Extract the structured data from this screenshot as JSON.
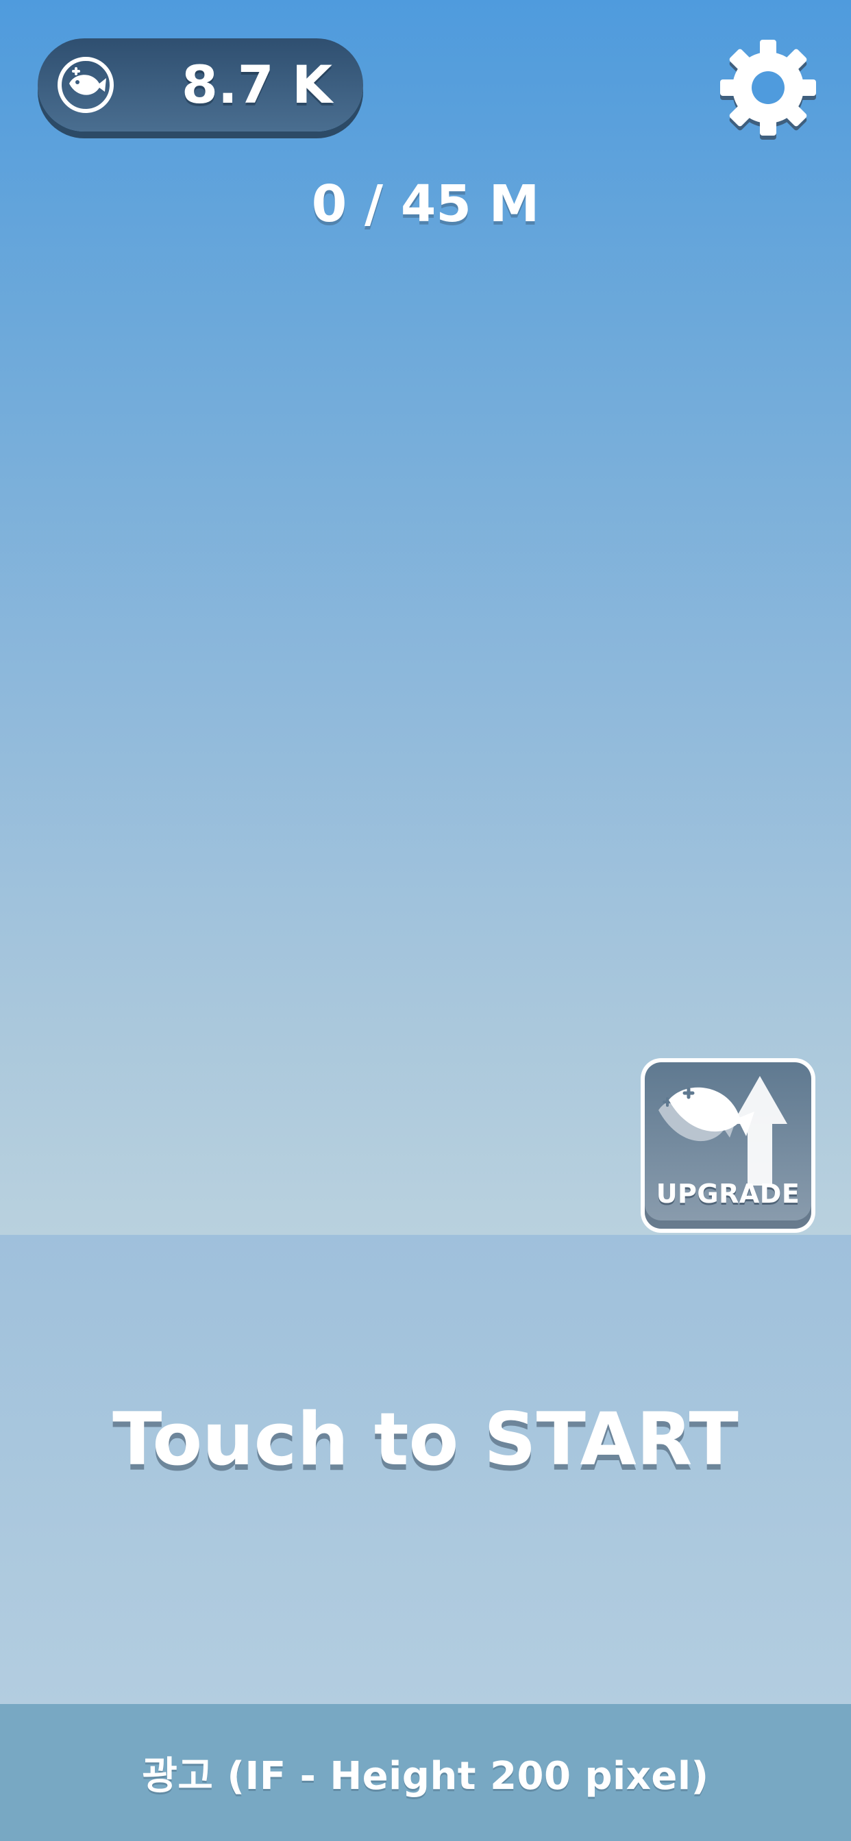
{
  "hud": {
    "currency_value": "8.7 K",
    "currency_icon": "fish-coin-icon",
    "settings_icon": "gear-icon",
    "distance_progress": "0 / 45 M"
  },
  "upgrade": {
    "label": "UPGRADE",
    "icon": "fish-upgrade-arrow-icon"
  },
  "start": {
    "prompt": "Touch to START"
  },
  "ad": {
    "text": "광고 (IF - Height 200 pixel)"
  },
  "colors": {
    "sky_top": "#4f9bdd",
    "sky_bottom": "#b9d1de",
    "sea": "#a9c7dd",
    "ad_banner": "#78a8c3",
    "pill": "#3b5d80"
  }
}
